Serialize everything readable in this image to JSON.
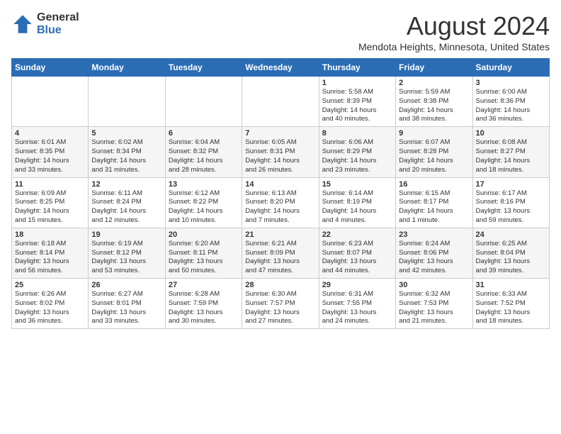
{
  "header": {
    "logo_general": "General",
    "logo_blue": "Blue",
    "month_title": "August 2024",
    "location": "Mendota Heights, Minnesota, United States"
  },
  "weekdays": [
    "Sunday",
    "Monday",
    "Tuesday",
    "Wednesday",
    "Thursday",
    "Friday",
    "Saturday"
  ],
  "weeks": [
    [
      {
        "day": "",
        "info": ""
      },
      {
        "day": "",
        "info": ""
      },
      {
        "day": "",
        "info": ""
      },
      {
        "day": "",
        "info": ""
      },
      {
        "day": "1",
        "info": "Sunrise: 5:58 AM\nSunset: 8:39 PM\nDaylight: 14 hours\nand 40 minutes."
      },
      {
        "day": "2",
        "info": "Sunrise: 5:59 AM\nSunset: 8:38 PM\nDaylight: 14 hours\nand 38 minutes."
      },
      {
        "day": "3",
        "info": "Sunrise: 6:00 AM\nSunset: 8:36 PM\nDaylight: 14 hours\nand 36 minutes."
      }
    ],
    [
      {
        "day": "4",
        "info": "Sunrise: 6:01 AM\nSunset: 8:35 PM\nDaylight: 14 hours\nand 33 minutes."
      },
      {
        "day": "5",
        "info": "Sunrise: 6:02 AM\nSunset: 8:34 PM\nDaylight: 14 hours\nand 31 minutes."
      },
      {
        "day": "6",
        "info": "Sunrise: 6:04 AM\nSunset: 8:32 PM\nDaylight: 14 hours\nand 28 minutes."
      },
      {
        "day": "7",
        "info": "Sunrise: 6:05 AM\nSunset: 8:31 PM\nDaylight: 14 hours\nand 26 minutes."
      },
      {
        "day": "8",
        "info": "Sunrise: 6:06 AM\nSunset: 8:29 PM\nDaylight: 14 hours\nand 23 minutes."
      },
      {
        "day": "9",
        "info": "Sunrise: 6:07 AM\nSunset: 8:28 PM\nDaylight: 14 hours\nand 20 minutes."
      },
      {
        "day": "10",
        "info": "Sunrise: 6:08 AM\nSunset: 8:27 PM\nDaylight: 14 hours\nand 18 minutes."
      }
    ],
    [
      {
        "day": "11",
        "info": "Sunrise: 6:09 AM\nSunset: 8:25 PM\nDaylight: 14 hours\nand 15 minutes."
      },
      {
        "day": "12",
        "info": "Sunrise: 6:11 AM\nSunset: 8:24 PM\nDaylight: 14 hours\nand 12 minutes."
      },
      {
        "day": "13",
        "info": "Sunrise: 6:12 AM\nSunset: 8:22 PM\nDaylight: 14 hours\nand 10 minutes."
      },
      {
        "day": "14",
        "info": "Sunrise: 6:13 AM\nSunset: 8:20 PM\nDaylight: 14 hours\nand 7 minutes."
      },
      {
        "day": "15",
        "info": "Sunrise: 6:14 AM\nSunset: 8:19 PM\nDaylight: 14 hours\nand 4 minutes."
      },
      {
        "day": "16",
        "info": "Sunrise: 6:15 AM\nSunset: 8:17 PM\nDaylight: 14 hours\nand 1 minute."
      },
      {
        "day": "17",
        "info": "Sunrise: 6:17 AM\nSunset: 8:16 PM\nDaylight: 13 hours\nand 59 minutes."
      }
    ],
    [
      {
        "day": "18",
        "info": "Sunrise: 6:18 AM\nSunset: 8:14 PM\nDaylight: 13 hours\nand 56 minutes."
      },
      {
        "day": "19",
        "info": "Sunrise: 6:19 AM\nSunset: 8:12 PM\nDaylight: 13 hours\nand 53 minutes."
      },
      {
        "day": "20",
        "info": "Sunrise: 6:20 AM\nSunset: 8:11 PM\nDaylight: 13 hours\nand 50 minutes."
      },
      {
        "day": "21",
        "info": "Sunrise: 6:21 AM\nSunset: 8:09 PM\nDaylight: 13 hours\nand 47 minutes."
      },
      {
        "day": "22",
        "info": "Sunrise: 6:23 AM\nSunset: 8:07 PM\nDaylight: 13 hours\nand 44 minutes."
      },
      {
        "day": "23",
        "info": "Sunrise: 6:24 AM\nSunset: 8:06 PM\nDaylight: 13 hours\nand 42 minutes."
      },
      {
        "day": "24",
        "info": "Sunrise: 6:25 AM\nSunset: 8:04 PM\nDaylight: 13 hours\nand 39 minutes."
      }
    ],
    [
      {
        "day": "25",
        "info": "Sunrise: 6:26 AM\nSunset: 8:02 PM\nDaylight: 13 hours\nand 36 minutes."
      },
      {
        "day": "26",
        "info": "Sunrise: 6:27 AM\nSunset: 8:01 PM\nDaylight: 13 hours\nand 33 minutes."
      },
      {
        "day": "27",
        "info": "Sunrise: 6:28 AM\nSunset: 7:59 PM\nDaylight: 13 hours\nand 30 minutes."
      },
      {
        "day": "28",
        "info": "Sunrise: 6:30 AM\nSunset: 7:57 PM\nDaylight: 13 hours\nand 27 minutes."
      },
      {
        "day": "29",
        "info": "Sunrise: 6:31 AM\nSunset: 7:55 PM\nDaylight: 13 hours\nand 24 minutes."
      },
      {
        "day": "30",
        "info": "Sunrise: 6:32 AM\nSunset: 7:53 PM\nDaylight: 13 hours\nand 21 minutes."
      },
      {
        "day": "31",
        "info": "Sunrise: 6:33 AM\nSunset: 7:52 PM\nDaylight: 13 hours\nand 18 minutes."
      }
    ]
  ]
}
